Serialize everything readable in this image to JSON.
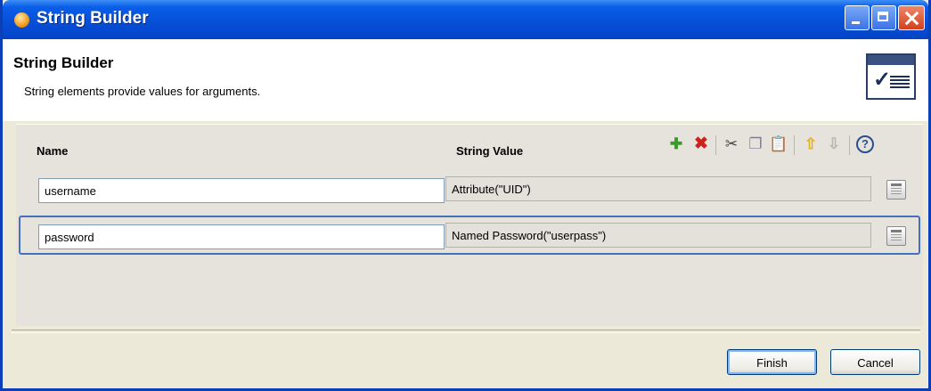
{
  "window": {
    "title": "String Builder"
  },
  "banner": {
    "title": "String Builder",
    "description": "String elements provide values for arguments."
  },
  "table": {
    "columns": [
      "Name",
      "String Value"
    ],
    "rows": [
      {
        "name": "username",
        "value": "Attribute(\"UID\")"
      },
      {
        "name": "password",
        "value": "Named Password(\"userpass\")"
      }
    ],
    "selected_row": 1
  },
  "toolbar": {
    "icons": [
      "add-icon",
      "delete-icon",
      "cut-icon",
      "copy-icon",
      "paste-icon",
      "move-up-icon",
      "move-down-icon",
      "help-icon"
    ],
    "help_glyph": "?"
  },
  "buttons": {
    "finish": "Finish",
    "cancel": "Cancel"
  },
  "colors": {
    "titlebar": "#0650d8",
    "selection_border": "#4472b9",
    "add": "#3c9a2c",
    "delete": "#d0201c"
  }
}
